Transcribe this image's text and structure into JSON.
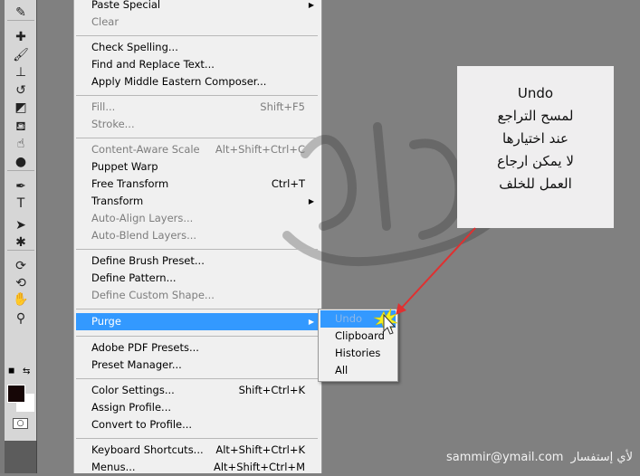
{
  "toolbar": {
    "tools": [
      {
        "icon": "eyedropper-icon",
        "glyph": "✎"
      },
      {
        "icon": "healing-brush-icon",
        "glyph": "✚"
      },
      {
        "icon": "brush-icon",
        "glyph": "🖌"
      },
      {
        "icon": "clone-stamp-icon",
        "glyph": "⊥"
      },
      {
        "icon": "history-brush-icon",
        "glyph": "↺"
      },
      {
        "icon": "eraser-icon",
        "glyph": "◩"
      },
      {
        "icon": "paint-bucket-icon",
        "glyph": "⛾"
      },
      {
        "icon": "blur-icon",
        "glyph": "☝"
      },
      {
        "icon": "dodge-icon",
        "glyph": "●"
      },
      {
        "icon": "pen-icon",
        "glyph": "✒"
      },
      {
        "icon": "type-icon",
        "glyph": "T"
      },
      {
        "icon": "path-selection-icon",
        "glyph": "➤"
      },
      {
        "icon": "custom-shape-icon",
        "glyph": "✱"
      },
      {
        "icon": "3d-rotate-icon",
        "glyph": "⟳"
      },
      {
        "icon": "3d-orbit-icon",
        "glyph": "⟲"
      },
      {
        "icon": "hand-icon",
        "glyph": "✋"
      },
      {
        "icon": "zoom-icon",
        "glyph": "⚲"
      }
    ],
    "foreground_color": "#160606",
    "background_color": "#ffffff",
    "swap_glyph": "⇆",
    "default_glyph": "◼",
    "quickmask_glyph": "○"
  },
  "menu": {
    "items": [
      {
        "label": "Paste Special",
        "submenu": true
      },
      {
        "label": "Clear",
        "disabled": true
      },
      {
        "sep": true
      },
      {
        "label": "Check Spelling..."
      },
      {
        "label": "Find and Replace Text..."
      },
      {
        "label": "Apply Middle Eastern Composer..."
      },
      {
        "sep": true
      },
      {
        "label": "Fill...",
        "shortcut": "Shift+F5",
        "disabled": true
      },
      {
        "label": "Stroke...",
        "disabled": true
      },
      {
        "sep": true
      },
      {
        "label": "Content-Aware Scale",
        "shortcut": "Alt+Shift+Ctrl+C",
        "disabled": true
      },
      {
        "label": "Puppet Warp"
      },
      {
        "label": "Free Transform",
        "shortcut": "Ctrl+T"
      },
      {
        "label": "Transform",
        "submenu": true
      },
      {
        "label": "Auto-Align Layers...",
        "disabled": true
      },
      {
        "label": "Auto-Blend Layers...",
        "disabled": true
      },
      {
        "sep": true
      },
      {
        "label": "Define Brush Preset..."
      },
      {
        "label": "Define Pattern..."
      },
      {
        "label": "Define Custom Shape...",
        "disabled": true
      },
      {
        "sep": true
      },
      {
        "label": "Purge",
        "submenu": true,
        "highlighted": true
      },
      {
        "sep": true
      },
      {
        "label": "Adobe PDF Presets..."
      },
      {
        "label": "Preset Manager..."
      },
      {
        "sep": true
      },
      {
        "label": "Color Settings...",
        "shortcut": "Shift+Ctrl+K"
      },
      {
        "label": "Assign Profile..."
      },
      {
        "label": "Convert to Profile..."
      },
      {
        "sep": true
      },
      {
        "label": "Keyboard Shortcuts...",
        "shortcut": "Alt+Shift+Ctrl+K"
      },
      {
        "label": "Menus...",
        "shortcut": "Alt+Shift+Ctrl+M"
      }
    ]
  },
  "submenu": {
    "items": [
      {
        "label": "Undo",
        "disabled": true,
        "highlighted": true
      },
      {
        "label": "Clipboard"
      },
      {
        "label": "Histories"
      },
      {
        "label": "All"
      }
    ]
  },
  "note": {
    "title": "Undo",
    "lines": [
      "لمسح التراجع",
      "عند اختيارها",
      "لا يمكن ارجاع",
      "العمل للخلف"
    ]
  },
  "footer": {
    "email": "sammir@ymail.com",
    "label": "لأي إستفسار"
  },
  "colors": {
    "highlight": "#3399ff",
    "arrow": "#e03030",
    "canvas": "#808080",
    "menu_bg": "#f0f0f0"
  }
}
